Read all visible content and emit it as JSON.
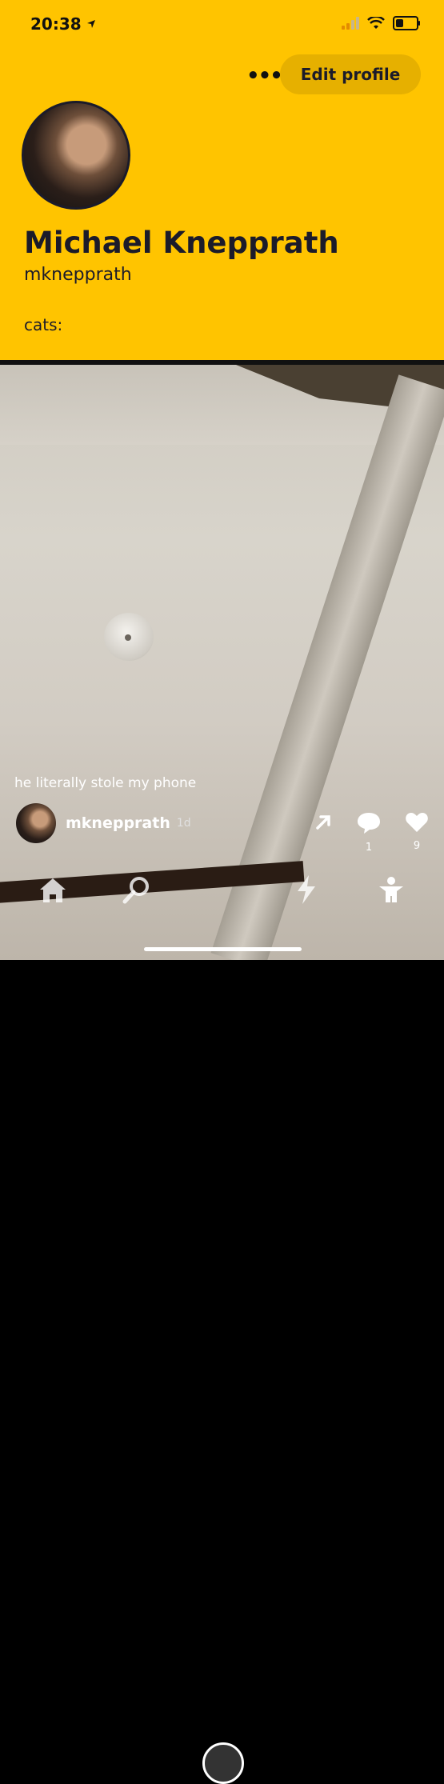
{
  "status_bar": {
    "time": "20:38"
  },
  "header": {
    "more_label": "•••",
    "edit_profile_label": "Edit profile",
    "name": "Michael Knepprath",
    "username": "mknepprath",
    "bio": "cats:"
  },
  "post": {
    "caption": "he literally stole my phone",
    "author": "mknepprath",
    "age": "1d",
    "comment_count": "1",
    "like_count": "9"
  },
  "colors": {
    "header_bg": "#ffc400",
    "button_bg": "#e6b000",
    "text_dark": "#1b1b2a"
  }
}
